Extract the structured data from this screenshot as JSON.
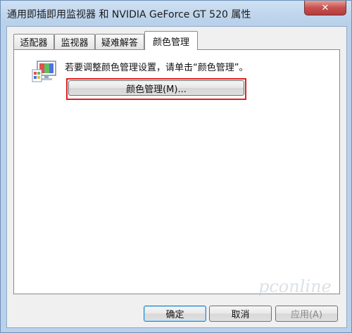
{
  "window": {
    "title": "通用即插即用监视器 和 NVIDIA GeForce GT 520  属性",
    "close_glyph": "✕"
  },
  "tabs": [
    {
      "label": "适配器",
      "active": false
    },
    {
      "label": "监视器",
      "active": false
    },
    {
      "label": "疑难解答",
      "active": false
    },
    {
      "label": "颜色管理",
      "active": true
    }
  ],
  "panel": {
    "description": "若要调整颜色管理设置，请单击“颜色管理”。",
    "color_management_button": "颜色管理(M)..."
  },
  "footer": {
    "ok_label": "确定",
    "cancel_label": "取消",
    "apply_label": "应用(A)"
  },
  "watermark": "pconline",
  "colors": {
    "highlight_box": "#e02020",
    "close_button": "#c75050",
    "title_bar": "#b9d1ea"
  }
}
